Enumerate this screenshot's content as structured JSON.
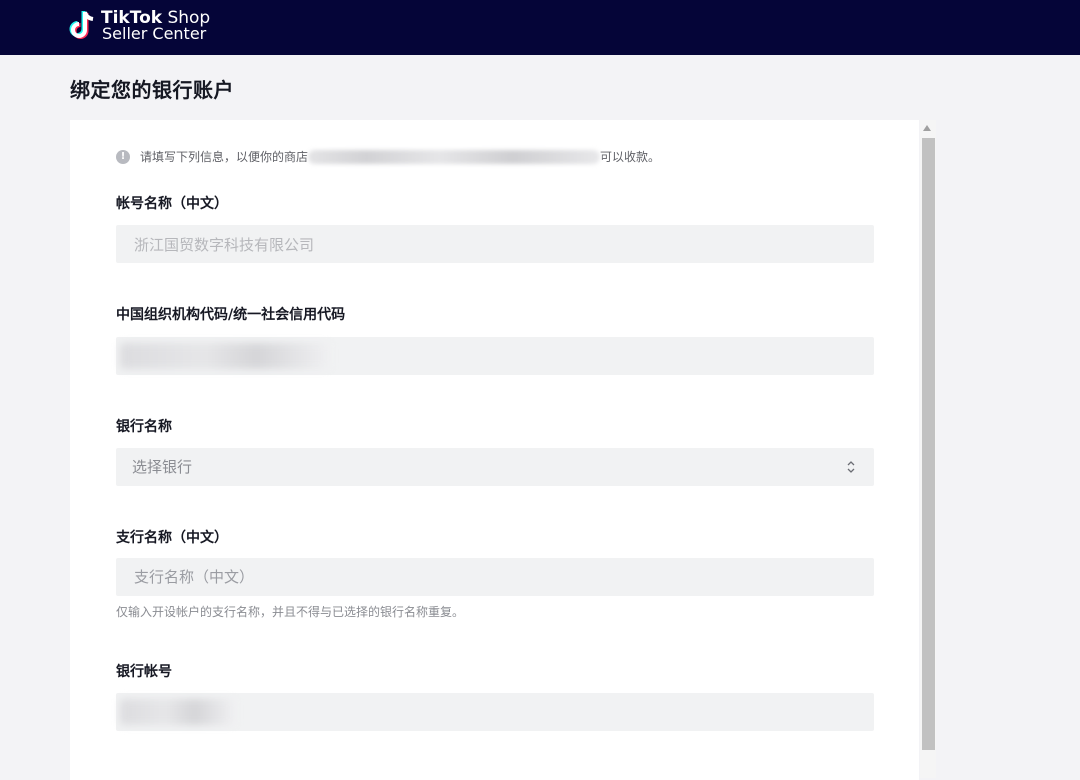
{
  "header": {
    "brand_line1_bold": "TikTok",
    "brand_line1_rest": " Shop",
    "brand_line2": "Seller Center",
    "background": "#050538"
  },
  "page": {
    "title": "绑定您的银行账户"
  },
  "notice": {
    "icon": "info-icon",
    "prefix": "请填写下列信息，以便你的商店",
    "suffix": "可以收款。"
  },
  "form": {
    "account_name": {
      "label": "帐号名称（中文）",
      "value": "浙江国贸数字科技有限公司"
    },
    "org_code": {
      "label": "中国组织机构代码/统一社会信用代码",
      "value": ""
    },
    "bank_name": {
      "label": "银行名称",
      "selected": "选择银行",
      "icon": "chevron-up-down-icon"
    },
    "branch_name": {
      "label": "支行名称（中文）",
      "placeholder": "支行名称（中文）",
      "helper": "仅输入开设帐户的支行名称，并且不得与已选择的银行名称重复。"
    },
    "account_number": {
      "label": "银行帐号",
      "value": ""
    }
  }
}
